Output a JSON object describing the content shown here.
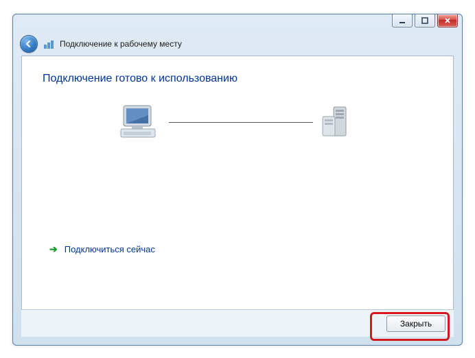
{
  "window": {
    "title": "Подключение к рабочему месту"
  },
  "content": {
    "headline": "Подключение готово к использованию",
    "connect_now": "Подключиться сейчас"
  },
  "footer": {
    "close_label": "Закрыть"
  },
  "icons": {
    "back": "back-arrow-icon",
    "network_wizard": "network-wizard-icon",
    "client_pc": "client-pc-icon",
    "server": "server-icon",
    "arrow_right": "arrow-right-icon",
    "minimize": "minimize-icon",
    "maximize": "maximize-icon",
    "close": "close-icon"
  }
}
